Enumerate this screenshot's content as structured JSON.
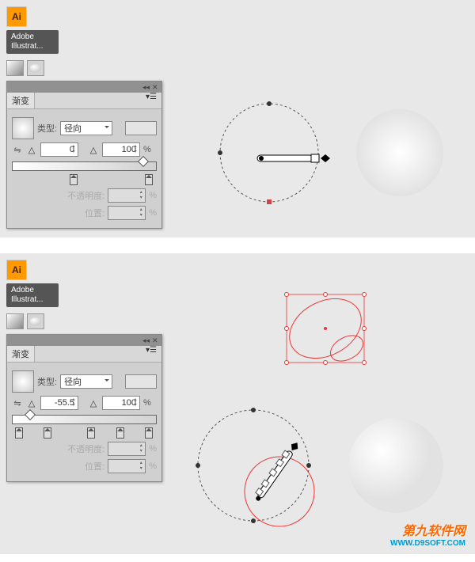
{
  "ai": {
    "icon_label": "Ai",
    "name": "Adobe Illustrat..."
  },
  "panel1": {
    "tab": "渐变",
    "type_label": "类型:",
    "type_val": "径向",
    "angle_sym": "△",
    "angle": "0",
    "asp_sym": "△",
    "asp": "100",
    "pct": "%",
    "opacity_lbl": "不透明度:",
    "opacity_val": "",
    "opacity_pct": "%",
    "pos_lbl": "位置:",
    "pos_val": "",
    "pos_pct": "%"
  },
  "panel2": {
    "tab": "渐变",
    "type_label": "类型:",
    "type_val": "径向",
    "angle_sym": "△",
    "angle": "-55.5",
    "asp_sym": "△",
    "asp": "100",
    "pct": "%",
    "opacity_lbl": "不透明度:",
    "opacity_val": "",
    "opacity_pct": "%",
    "pos_lbl": "位置:",
    "pos_val": "",
    "pos_pct": "%"
  },
  "wm": {
    "title": "第九软件网",
    "url": "WWW.D9SOFT.COM"
  }
}
